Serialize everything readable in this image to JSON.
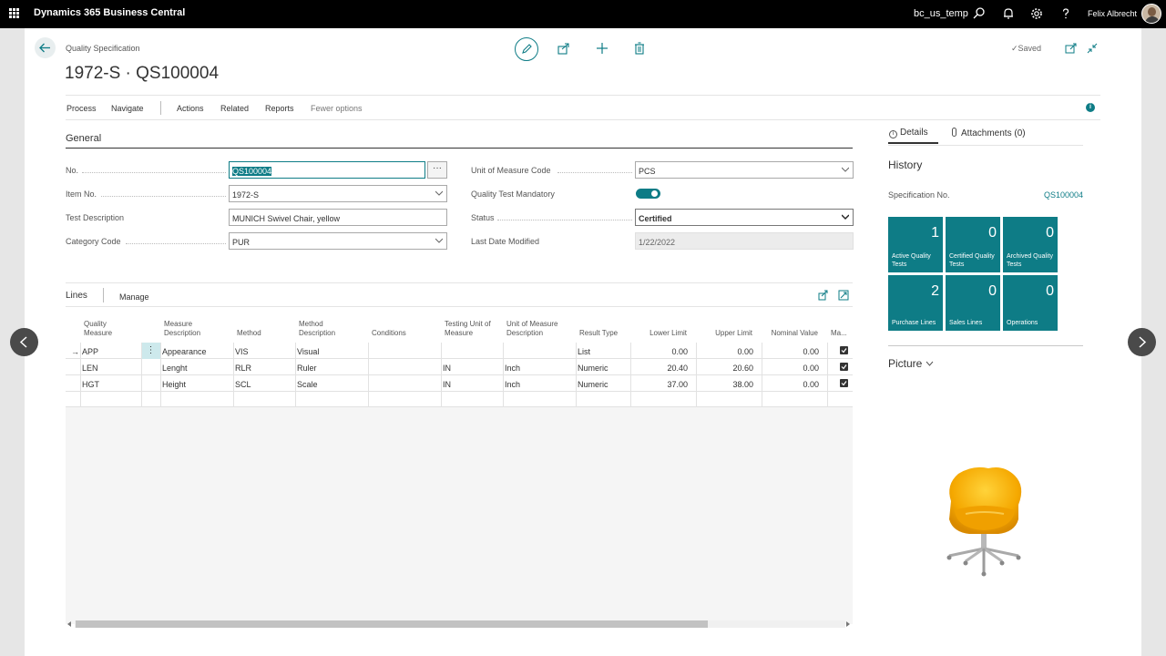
{
  "topbar": {
    "app_title": "Dynamics 365 Business Central",
    "environment": "bc_us_temp",
    "user_name": "Felix Albrecht",
    "icons": [
      "waffle-icon",
      "search-icon",
      "bell-icon",
      "gear-icon",
      "help-icon"
    ]
  },
  "header": {
    "breadcrumb": "Quality Specification",
    "title": "1972-S · QS100004",
    "status": "Saved",
    "icons": [
      "back-icon",
      "edit-icon",
      "share-icon",
      "add-icon",
      "delete-icon",
      "open-new-window-icon",
      "collapse-icon"
    ]
  },
  "action_bar": {
    "items": [
      "Process",
      "Navigate",
      "Actions",
      "Related",
      "Reports",
      "Fewer options"
    ]
  },
  "general": {
    "title": "General",
    "fields": {
      "no_label": "No.",
      "no_value": "QS100004",
      "item_no_label": "Item No.",
      "item_no_value": "1972-S",
      "test_desc_label": "Test Description",
      "test_desc_value": "MUNICH Swivel Chair, yellow",
      "category_label": "Category Code",
      "category_value": "PUR",
      "uom_label": "Unit of Measure Code",
      "uom_value": "PCS",
      "mandatory_label": "Quality Test Mandatory",
      "mandatory_value": true,
      "status_label": "Status",
      "status_value": "Certified",
      "last_modified_label": "Last Date Modified",
      "last_modified_value": "1/22/2022",
      "ellipsis": "···"
    }
  },
  "lines": {
    "title": "Lines",
    "manage": "Manage",
    "columns": {
      "quality_measure": [
        "Quality",
        "Measure"
      ],
      "measure_desc": [
        "Measure",
        "Description"
      ],
      "method": "Method",
      "method_desc": [
        "Method",
        "Description"
      ],
      "conditions": "Conditions",
      "testing_uom": [
        "Testing Unit of",
        "Measure"
      ],
      "uom_desc": [
        "Unit of Measure",
        "Description"
      ],
      "result_type": "Result Type",
      "lower_limit": "Lower Limit",
      "upper_limit": "Upper Limit",
      "nominal_value": "Nominal Value",
      "mandatory": "Ma..."
    },
    "rows": [
      {
        "measure": "APP",
        "desc": "Appearance",
        "method": "VIS",
        "method_desc": "Visual",
        "conditions": "",
        "testing_uom": "",
        "uom_desc": "",
        "result_type": "List",
        "lower": "0.00",
        "upper": "0.00",
        "nominal": "0.00",
        "mandatory": true
      },
      {
        "measure": "LEN",
        "desc": "Lenght",
        "method": "RLR",
        "method_desc": "Ruler",
        "conditions": "",
        "testing_uom": "IN",
        "uom_desc": "Inch",
        "result_type": "Numeric",
        "lower": "20.40",
        "upper": "20.60",
        "nominal": "0.00",
        "mandatory": true
      },
      {
        "measure": "HGT",
        "desc": "Height",
        "method": "SCL",
        "method_desc": "Scale",
        "conditions": "",
        "testing_uom": "IN",
        "uom_desc": "Inch",
        "result_type": "Numeric",
        "lower": "37.00",
        "upper": "38.00",
        "nominal": "0.00",
        "mandatory": true
      }
    ],
    "row_menu": "⋮",
    "current_row_arrow": "→"
  },
  "factbox": {
    "tab_details": "Details",
    "tab_attachments": "Attachments (0)",
    "history_title": "History",
    "spec_no_label": "Specification No.",
    "spec_no_value": "QS100004",
    "cues": [
      {
        "value": "1",
        "label": "Active Quality Tests"
      },
      {
        "value": "0",
        "label": "Certified Quality Tests"
      },
      {
        "value": "0",
        "label": "Archived Quality Tests"
      },
      {
        "value": "2",
        "label": "Purchase Lines"
      },
      {
        "value": "0",
        "label": "Sales Lines"
      },
      {
        "value": "0",
        "label": "Operations"
      }
    ],
    "picture_title": "Picture"
  },
  "colors": {
    "accent": "#0e7c86",
    "topbar": "#000000"
  }
}
